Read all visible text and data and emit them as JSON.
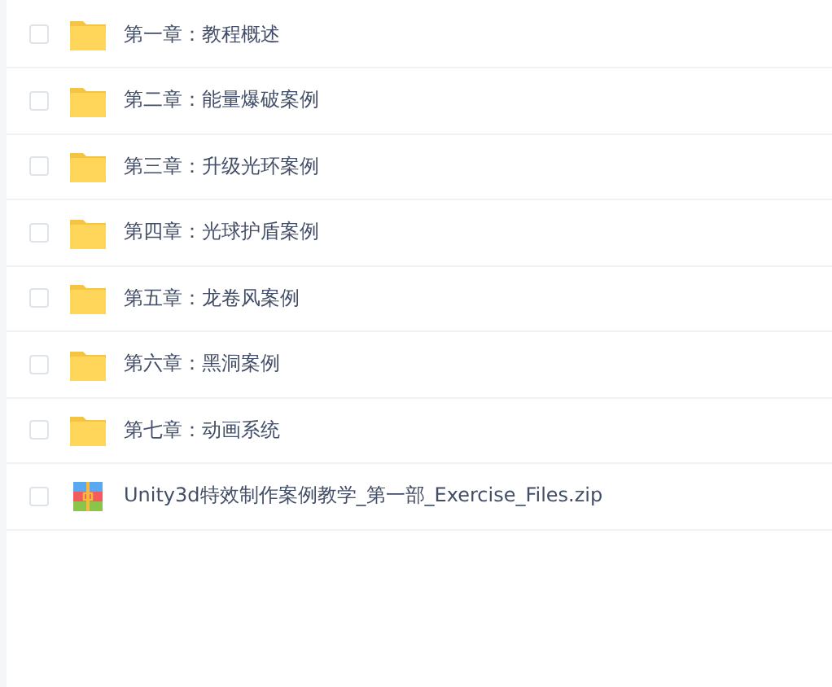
{
  "files": [
    {
      "kind": "folder",
      "name": "第一章：教程概述",
      "checked": false
    },
    {
      "kind": "folder",
      "name": "第二章：能量爆破案例",
      "checked": false
    },
    {
      "kind": "folder",
      "name": "第三章：升级光环案例",
      "checked": false
    },
    {
      "kind": "folder",
      "name": "第四章：光球护盾案例",
      "checked": false
    },
    {
      "kind": "folder",
      "name": "第五章：龙卷风案例",
      "checked": false
    },
    {
      "kind": "folder",
      "name": "第六章：黑洞案例",
      "checked": false
    },
    {
      "kind": "folder",
      "name": "第七章：动画系统",
      "checked": false
    },
    {
      "kind": "zip",
      "name": "Unity3d特效制作案例教学_第一部_Exercise_Files.zip",
      "checked": false
    }
  ]
}
